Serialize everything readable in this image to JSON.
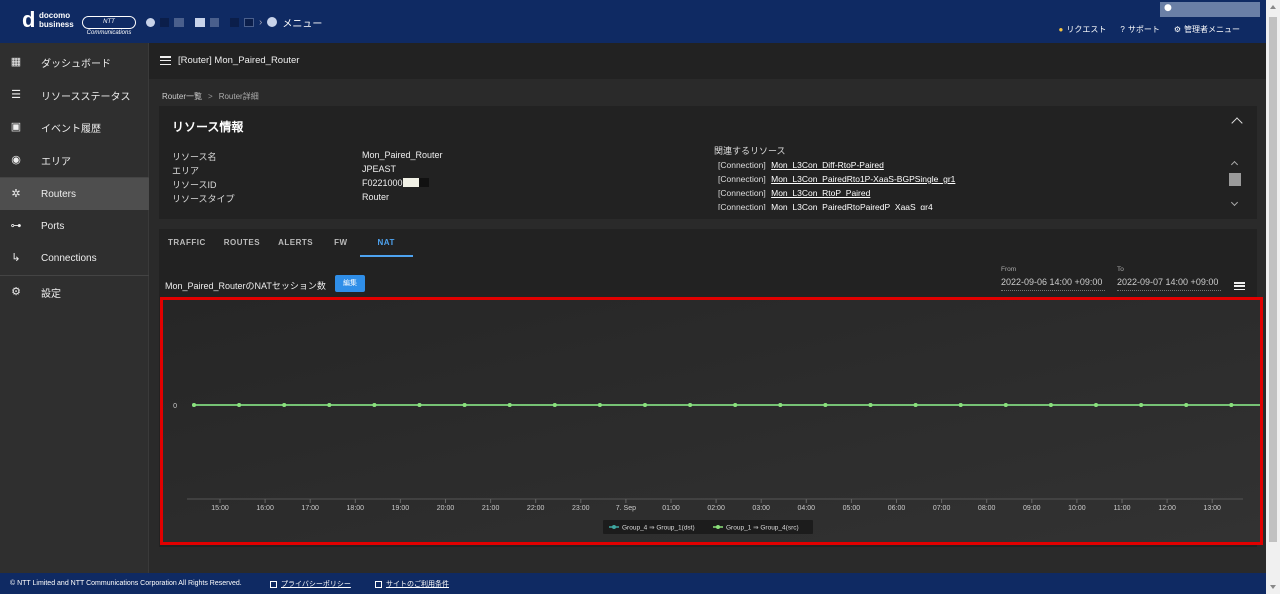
{
  "header": {
    "logo_d": "d",
    "logo_line1": "docomo",
    "logo_line2": "business",
    "ntt_badge": "NTT Communications",
    "menu_label": "メニュー",
    "top_links": [
      "リクエスト",
      "サポート",
      "管理者メニュー"
    ]
  },
  "sidebar": {
    "items": [
      {
        "label": "ダッシュボード",
        "icon": "grid-icon"
      },
      {
        "label": "リソースステータス",
        "icon": "status-list-icon"
      },
      {
        "label": "イベント履歴",
        "icon": "calendar-check-icon"
      },
      {
        "label": "エリア",
        "icon": "globe-pin-icon"
      },
      {
        "label": "Routers",
        "icon": "router-icon"
      },
      {
        "label": "Ports",
        "icon": "port-toggle-icon"
      },
      {
        "label": "Connections",
        "icon": "connection-icon"
      },
      {
        "label": "設定",
        "icon": "gear-icon"
      }
    ],
    "active_index": 4
  },
  "page": {
    "title": "[Router] Mon_Paired_Router",
    "breadcrumb": [
      "Router一覧",
      ">",
      "Router詳細"
    ]
  },
  "resource": {
    "heading": "リソース情報",
    "rows": [
      {
        "label": "リソース名",
        "value": "Mon_Paired_Router"
      },
      {
        "label": "エリア",
        "value": "JPEAST"
      },
      {
        "label": "リソースID",
        "value": "F0221000"
      },
      {
        "label": "リソースタイプ",
        "value": "Router"
      }
    ],
    "related_title": "関連するリソース",
    "related": [
      {
        "type": "[Connection]",
        "name": "Mon_L3Con_Diff-RtoP-Paired"
      },
      {
        "type": "[Connection]",
        "name": "Mon_L3Con_PairedRto1P-XaaS-BGPSingle_gr1"
      },
      {
        "type": "[Connection]",
        "name": "Mon_L3Con_RtoP_Paired"
      },
      {
        "type": "[Connection]",
        "name": "Mon_L3Con_PairedRtoPairedP_XaaS_gr4"
      }
    ]
  },
  "tabs": [
    "TRAFFIC",
    "ROUTES",
    "ALERTS",
    "FW",
    "NAT"
  ],
  "active_tab": 4,
  "nat": {
    "title": "Mon_Paired_RouterのNATセッション数",
    "edit_label": "編集",
    "from_label": "From",
    "from_value": "2022-09-06 14:00 +09:00",
    "to_label": "To",
    "to_value": "2022-09-07 14:00 +09:00"
  },
  "chart_data": {
    "type": "line",
    "x": [
      "15:00",
      "16:00",
      "17:00",
      "18:00",
      "19:00",
      "20:00",
      "21:00",
      "22:00",
      "23:00",
      "7. Sep",
      "01:00",
      "02:00",
      "03:00",
      "04:00",
      "05:00",
      "06:00",
      "07:00",
      "08:00",
      "09:00",
      "10:00",
      "11:00",
      "12:00",
      "13:00"
    ],
    "y_ticks": [
      0
    ],
    "series": [
      {
        "name": "Group_4 ⇒ Group_1(dst)",
        "color": "#3fa7a0",
        "values": [
          0,
          0,
          0,
          0,
          0,
          0,
          0,
          0,
          0,
          0,
          0,
          0,
          0,
          0,
          0,
          0,
          0,
          0,
          0,
          0,
          0,
          0,
          0,
          0,
          0
        ]
      },
      {
        "name": "Group_1 ⇒ Group_4(src)",
        "color": "#8be07a",
        "values": [
          0,
          0,
          0,
          0,
          0,
          0,
          0,
          0,
          0,
          0,
          0,
          0,
          0,
          0,
          0,
          0,
          0,
          0,
          0,
          0,
          0,
          0,
          0,
          0,
          0
        ]
      }
    ],
    "legend_position": "bottom-center"
  },
  "footer": {
    "copyright": "© NTT Limited and NTT Communications Corporation All Rights Reserved.",
    "links": [
      "プライバシーポリシー",
      "サイトのご利用条件"
    ]
  }
}
